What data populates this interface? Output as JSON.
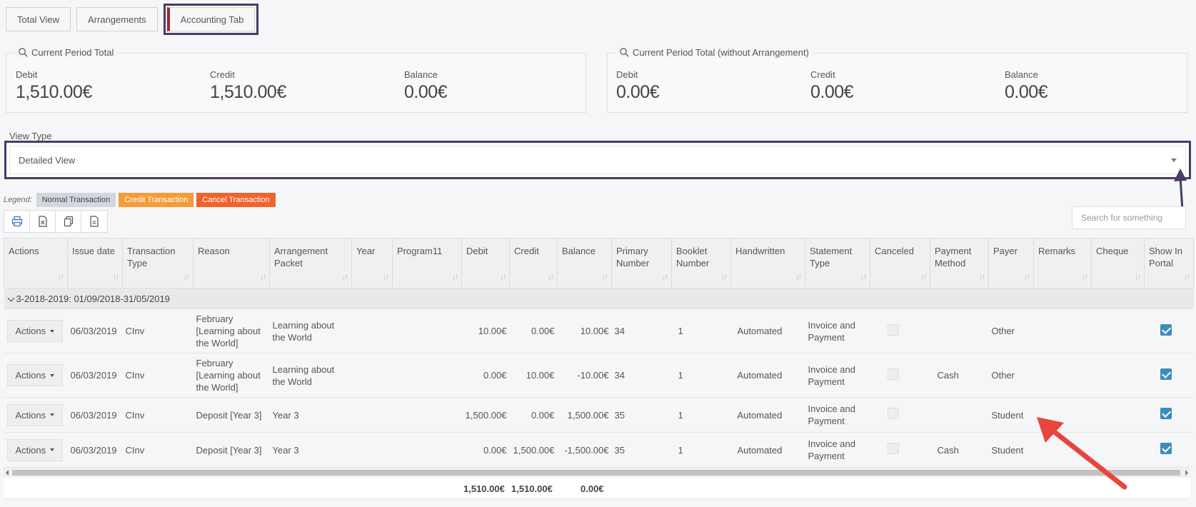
{
  "tabs": [
    {
      "label": "Total View"
    },
    {
      "label": "Arrangements"
    },
    {
      "label": "Accounting Tab"
    }
  ],
  "panel_left": {
    "title": "Current Period Total",
    "debit_label": "Debit",
    "debit_value": "1,510.00€",
    "credit_label": "Credit",
    "credit_value": "1,510.00€",
    "balance_label": "Balance",
    "balance_value": "0.00€"
  },
  "panel_right": {
    "title": "Current Period Total (without Arrangement)",
    "debit_label": "Debit",
    "debit_value": "0.00€",
    "credit_label": "Credit",
    "credit_value": "0.00€",
    "balance_label": "Balance",
    "balance_value": "0.00€"
  },
  "view_type": {
    "label": "View Type",
    "selected": "Detailed View"
  },
  "legend": {
    "title": "Legend:",
    "normal": "Normal Transaction",
    "credit": "Credit Transaction",
    "cancel": "Cancel Transaction"
  },
  "search": {
    "placeholder": "Search for something"
  },
  "columns": [
    "Actions",
    "Issue date",
    "Transaction Type",
    "Reason",
    "Arrangement Packet",
    "Year",
    "Program11",
    "Debit",
    "Credit",
    "Balance",
    "Primary Number",
    "Booklet Number",
    "Handwritten",
    "Statement Type",
    "Canceled",
    "Payment Method",
    "Payer",
    "Remarks",
    "Cheque",
    "Show In Portal"
  ],
  "group": {
    "label": "3-2018-2019: 01/09/2018-31/05/2019"
  },
  "rows": [
    {
      "action": "Actions",
      "date": "06/03/2019",
      "type": "CInv",
      "reason": "February [Learning about the World]",
      "packet": "Learning about the World",
      "debit": "10.00€",
      "credit": "0.00€",
      "balance": "10.00€",
      "primary": "34",
      "booklet": "1",
      "handwritten": "Automated",
      "statement": "Invoice and Payment",
      "method": "",
      "payer": "Other"
    },
    {
      "action": "Actions",
      "date": "06/03/2019",
      "type": "CInv",
      "reason": "February [Learning about the World]",
      "packet": "Learning about the World",
      "debit": "0.00€",
      "credit": "10.00€",
      "balance": "-10.00€",
      "primary": "34",
      "booklet": "1",
      "handwritten": "Automated",
      "statement": "Invoice and Payment",
      "method": "Cash",
      "payer": "Other"
    },
    {
      "action": "Actions",
      "date": "06/03/2019",
      "type": "CInv",
      "reason": "Deposit [Year 3]",
      "packet": "Year 3",
      "debit": "1,500.00€",
      "credit": "0.00€",
      "balance": "1,500.00€",
      "primary": "35",
      "booklet": "1",
      "handwritten": "Automated",
      "statement": "Invoice and Payment",
      "method": "",
      "payer": "Student"
    },
    {
      "action": "Actions",
      "date": "06/03/2019",
      "type": "CInv",
      "reason": "Deposit [Year 3]",
      "packet": "Year 3",
      "debit": "0.00€",
      "credit": "1,500.00€",
      "balance": "-1,500.00€",
      "primary": "35",
      "booklet": "1",
      "handwritten": "Automated",
      "statement": "Invoice and Payment",
      "method": "Cash",
      "payer": "Student"
    }
  ],
  "totals": {
    "debit": "1,510.00€",
    "credit": "1,510.00€",
    "balance": "0.00€"
  },
  "colors": {
    "annotation_box": "#4a3b68",
    "annotation_arrow": "#e8453c",
    "checkbox": "#3c8dbc"
  }
}
